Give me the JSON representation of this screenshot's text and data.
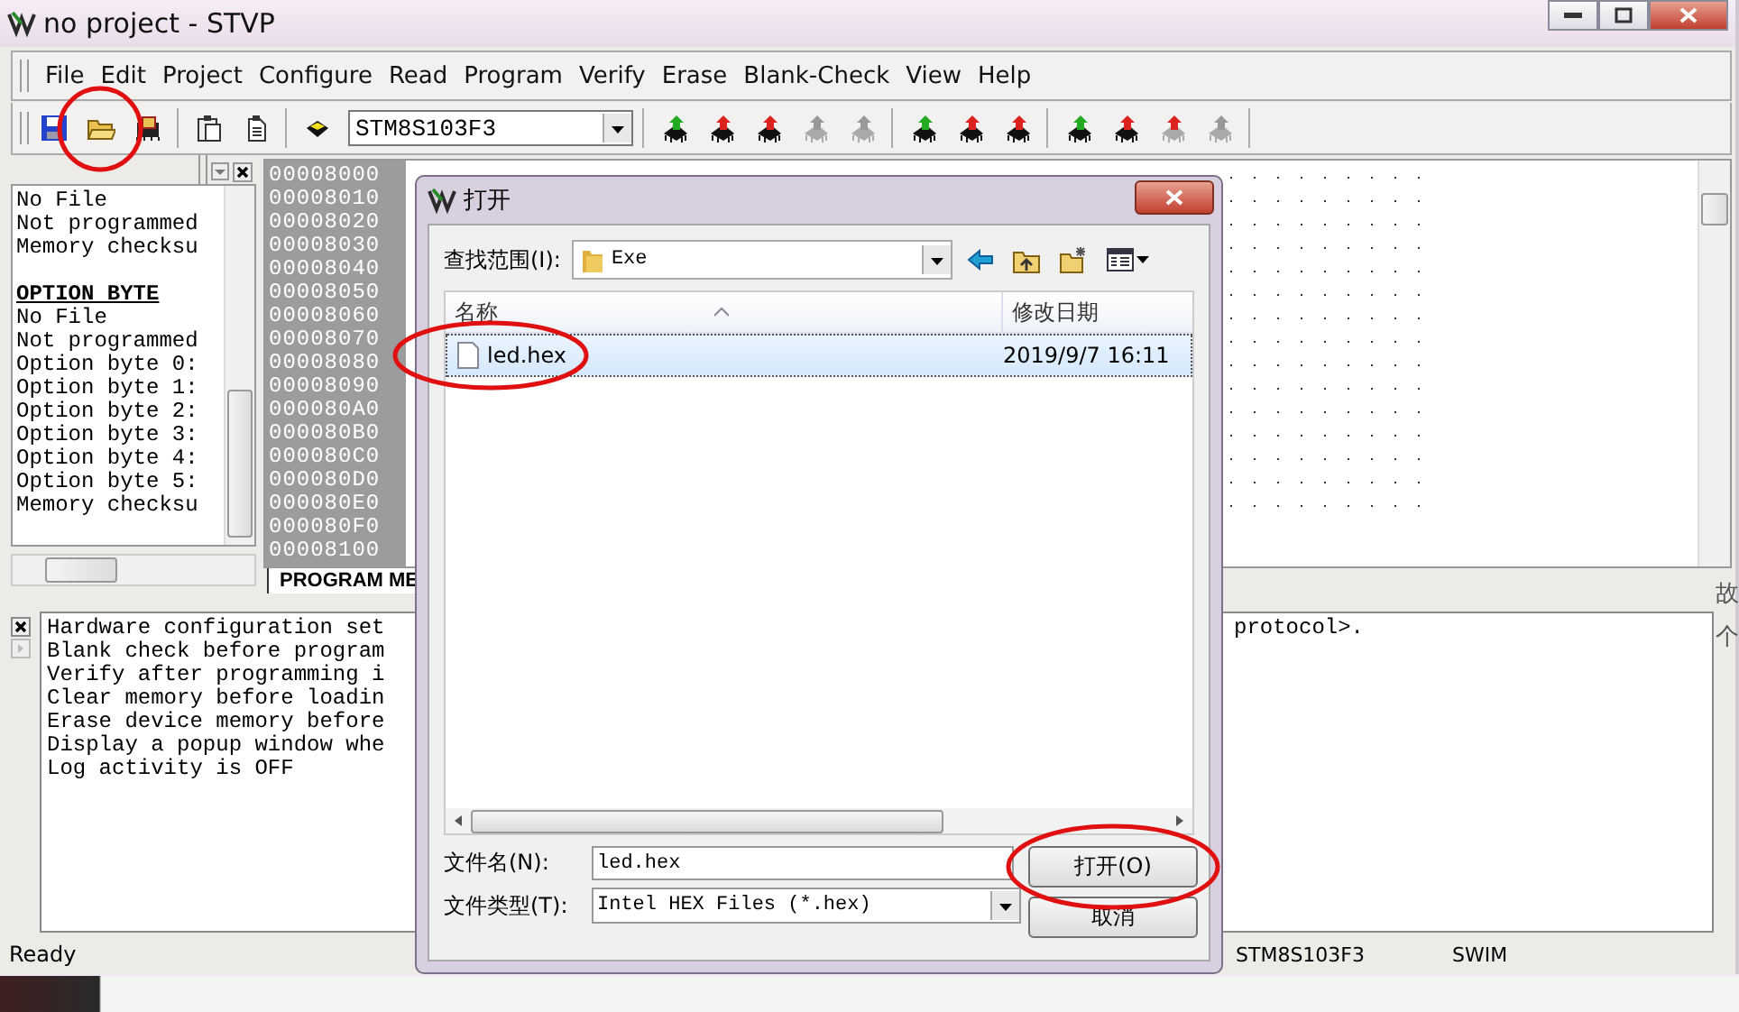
{
  "window": {
    "title": "no project - STVP"
  },
  "menu": [
    "File",
    "Edit",
    "Project",
    "Configure",
    "Read",
    "Program",
    "Verify",
    "Erase",
    "Blank-Check",
    "View",
    "Help"
  ],
  "toolbar": {
    "file_buttons": [
      {
        "kind": "save",
        "circled": false
      },
      {
        "kind": "open",
        "circled": true
      },
      {
        "kind": "project",
        "circled": false
      },
      {
        "kind": "paste",
        "circled": false
      },
      {
        "kind": "document",
        "circled": false
      }
    ],
    "device": "STM8S103F3",
    "chip_groups": [
      [
        {
          "color": "#22aa22",
          "disabled": false
        },
        {
          "color": "#dd2222",
          "disabled": false
        },
        {
          "color": "#dd2222",
          "disabled": false
        },
        {
          "color": "#999999",
          "disabled": true
        },
        {
          "color": "#999999",
          "disabled": true
        }
      ],
      [
        {
          "color": "#22aa22",
          "disabled": false
        },
        {
          "color": "#dd2222",
          "disabled": false
        },
        {
          "color": "#dd2222",
          "disabled": false
        }
      ],
      [
        {
          "color": "#22aa22",
          "disabled": false
        },
        {
          "color": "#dd2222",
          "disabled": false
        },
        {
          "color": "#dd2222",
          "disabled": true
        },
        {
          "color": "#999999",
          "disabled": true
        }
      ]
    ]
  },
  "info_panel": {
    "lines": [
      {
        "kind": "text",
        "text": "No File"
      },
      {
        "kind": "text",
        "text": "Not programmed"
      },
      {
        "kind": "text",
        "text": "Memory checksu"
      },
      {
        "kind": "heading",
        "text": "OPTION BYTE"
      },
      {
        "kind": "text",
        "text": "No File"
      },
      {
        "kind": "text",
        "text": "Not programmed"
      },
      {
        "kind": "text",
        "text": "Option byte 0:"
      },
      {
        "kind": "text",
        "text": "Option byte 1:"
      },
      {
        "kind": "text",
        "text": "Option byte 2:"
      },
      {
        "kind": "text",
        "text": "Option byte 3:"
      },
      {
        "kind": "text",
        "text": "Option byte 4:"
      },
      {
        "kind": "text",
        "text": "Option byte 5:"
      },
      {
        "kind": "text",
        "text": "Memory checksu"
      }
    ]
  },
  "memory": {
    "addresses": [
      "00008000",
      "00008010",
      "00008020",
      "00008030",
      "00008040",
      "00008050",
      "00008060",
      "00008070",
      "00008080",
      "00008090",
      "000080A0",
      "000080B0",
      "000080C0",
      "000080D0",
      "000080E0",
      "000080F0",
      "00008100"
    ],
    "tabs": [
      {
        "label": "PROGRAM ME",
        "selected": true
      }
    ]
  },
  "log": {
    "lines": [
      {
        "text": "Hardware configuration set",
        "tail": "protocol>."
      },
      {
        "text": "Blank check before program"
      },
      {
        "text": "Verify after programming i"
      },
      {
        "text": "Clear memory before loadin"
      },
      {
        "text": "Erase device memory before"
      },
      {
        "text": "Display a popup window whe"
      },
      {
        "text": "Log activity is OFF"
      }
    ]
  },
  "status_bar": [
    "Ready",
    "STM8S103F3",
    "SWIM"
  ],
  "background_text": [
    "故",
    "个"
  ],
  "dialog": {
    "title": "打开",
    "look_in_label": "查找范围(I):",
    "look_in": "Exe",
    "columns": [
      "名称",
      "修改日期"
    ],
    "files": [
      {
        "name": "led.hex",
        "modified": "2019/9/7 16:11",
        "selected": true,
        "circled": true
      }
    ],
    "file_name_label": "文件名(N):",
    "file_name": "led.hex",
    "file_type_label": "文件类型(T):",
    "file_type": "Intel HEX Files (*.hex)",
    "buttons": [
      {
        "label": "打开(O)",
        "circled": true
      },
      {
        "label": "取消",
        "circled": false
      }
    ]
  }
}
